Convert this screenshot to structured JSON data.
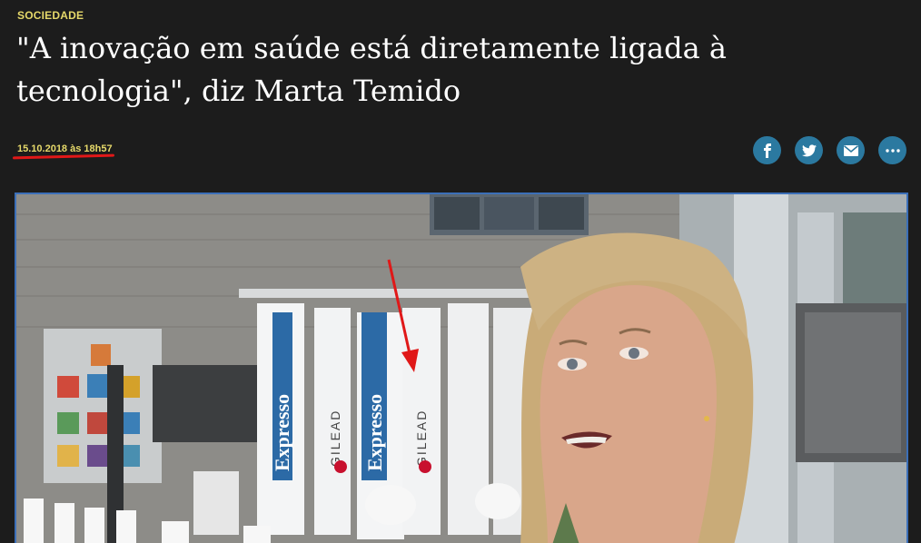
{
  "article": {
    "section": "SOCIEDADE",
    "headline": "\"A inovação em saúde está diretamente ligada à tecnologia\", diz Marta Temido",
    "date": "15.10.2018 às 18h57"
  },
  "share": {
    "icons": [
      "facebook-icon",
      "twitter-icon",
      "email-icon",
      "more-icon"
    ]
  },
  "media": {
    "banners": [
      "Expresso",
      "GILEAD",
      "Expresso",
      "GILEAD"
    ]
  },
  "colors": {
    "background": "#1c1c1c",
    "accent_yellow": "#e6d96a",
    "share_blue": "#2b79a0",
    "annotation_red": "#e01818",
    "frame_blue": "#3b6fb8"
  }
}
